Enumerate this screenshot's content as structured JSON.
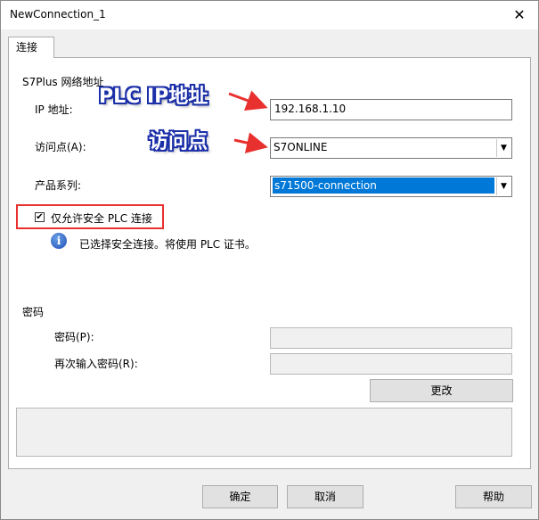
{
  "window": {
    "title": "NewConnection_1",
    "close_glyph": "✕"
  },
  "tab": {
    "label": "连接"
  },
  "network": {
    "group_label": "S7Plus 网络地址",
    "ip_label": "IP 地址:",
    "ip_value": "192.168.1.10",
    "access_point_label": "访问点(A):",
    "access_point_value": "S7ONLINE",
    "product_series_label": "产品系列:",
    "product_series_value": "s71500-connection"
  },
  "security": {
    "checkbox_label": "仅允许安全 PLC 连接",
    "checked": true,
    "check_glyph": "✔",
    "info_text": "已选择安全连接。将使用 PLC 证书。",
    "info_glyph": "i"
  },
  "password": {
    "group_label": "密码",
    "password_label": "密码(P):",
    "password_value": "",
    "confirm_label": "再次输入密码(R):",
    "confirm_value": "",
    "change_button": "更改"
  },
  "annotations": {
    "callout_ip": "PLC IP地址",
    "callout_access_point": "访问点",
    "arrow_color": "#e8312f",
    "callout_color": "#1b2fa8"
  },
  "footer": {
    "ok_button": "确定",
    "cancel_button": "取消",
    "help_button": "帮助"
  },
  "arrow_glyph": "▼"
}
